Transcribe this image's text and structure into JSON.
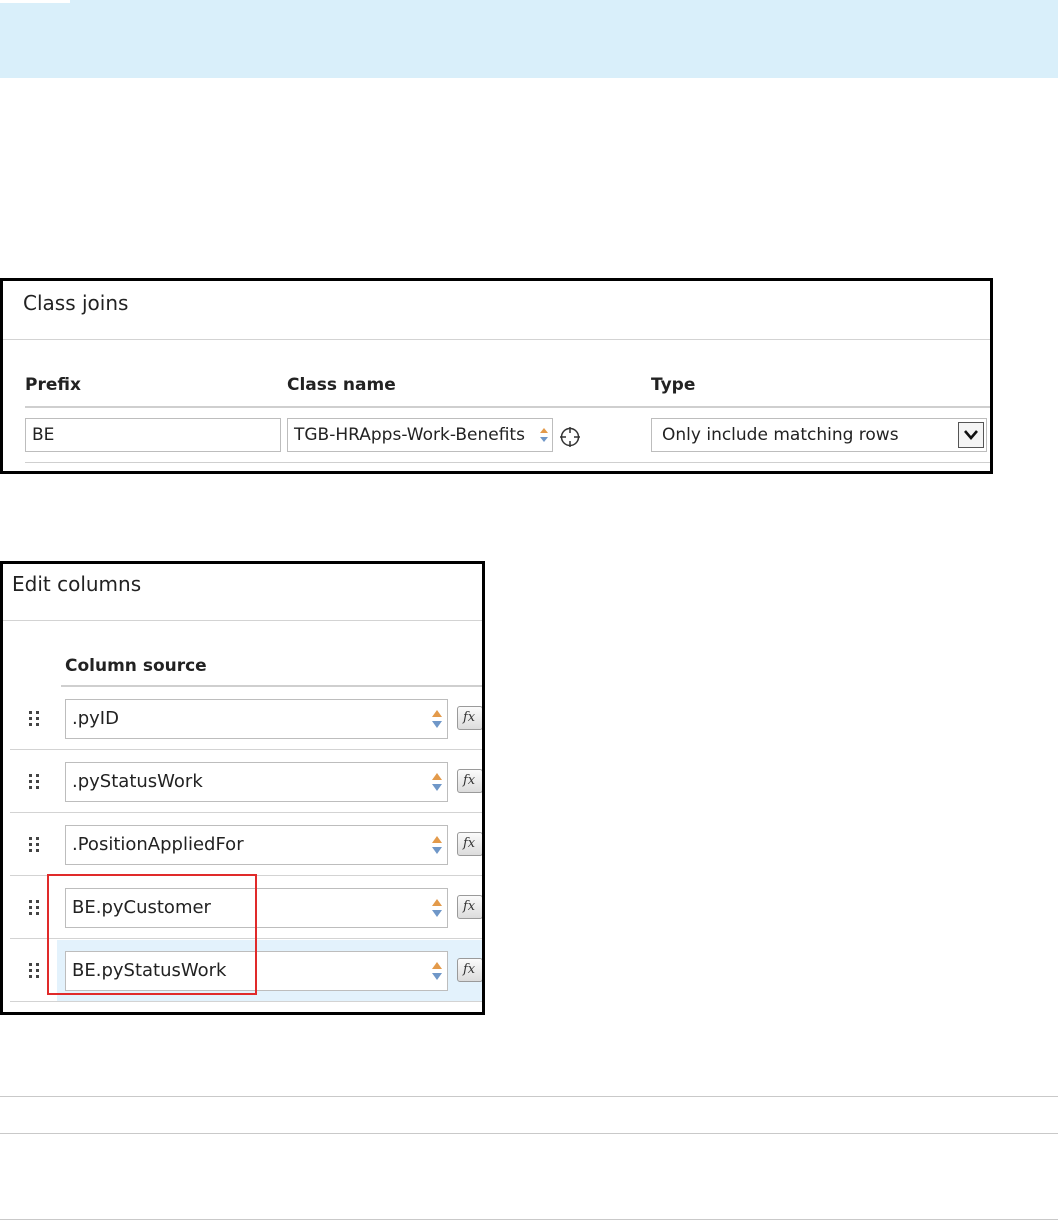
{
  "class_joins": {
    "title": "Class joins",
    "headers": {
      "prefix": "Prefix",
      "class_name": "Class name",
      "type": "Type"
    },
    "row": {
      "prefix": "BE",
      "class_name": "TGB-HRApps-Work-Benefits",
      "type": "Only include matching rows"
    }
  },
  "edit_columns": {
    "title": "Edit columns",
    "header": "Column source",
    "rows": [
      {
        "value": ".pyID"
      },
      {
        "value": ".pyStatusWork"
      },
      {
        "value": ".PositionAppliedFor"
      },
      {
        "value": "BE.pyCustomer"
      },
      {
        "value": "BE.pyStatusWork"
      }
    ],
    "fx_label": "fx"
  },
  "colors": {
    "banner": "#d9effa",
    "highlight": "#e02a2a",
    "selected_row": "#e3f2fc"
  },
  "icons": [
    "crosshair-icon",
    "chevron-down-icon",
    "drag-handle-icon",
    "sort-arrows-icon",
    "function-icon"
  ]
}
